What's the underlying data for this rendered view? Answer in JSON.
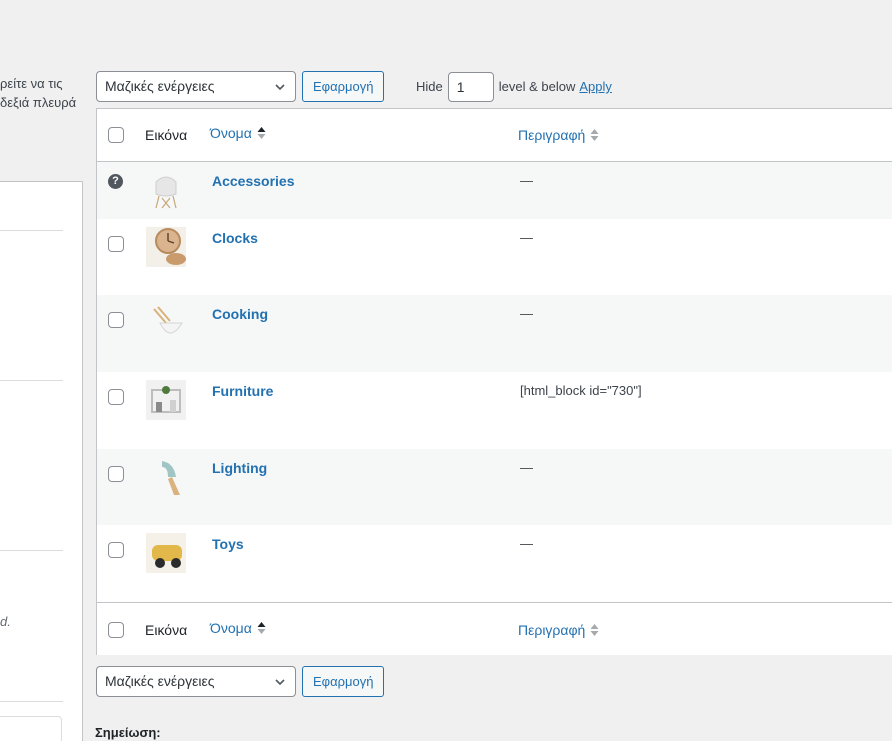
{
  "left": {
    "desc_line1": "ρείτε να τις",
    "desc_line2": "δεξιά πλευρά",
    "italic_text": "d."
  },
  "bulk_top": {
    "selected": "Μαζικές ενέργειες",
    "apply_label": "Εφαρμογή"
  },
  "bulk_bottom": {
    "selected": "Μαζικές ενέργειες",
    "apply_label": "Εφαρμογή"
  },
  "hide_control": {
    "prefix": "Hide",
    "value": "1",
    "suffix": "level & below",
    "apply_link": "Apply"
  },
  "table": {
    "columns": {
      "image": "Εικόνα",
      "name": "Όνομα",
      "description": "Περιγραφή"
    },
    "rows": [
      {
        "name": "Accessories",
        "description": "—",
        "thumb_icon": "chair-thumbnail"
      },
      {
        "name": "Clocks",
        "description": "—",
        "thumb_icon": "clock-thumbnail"
      },
      {
        "name": "Cooking",
        "description": "—",
        "thumb_icon": "bowl-thumbnail"
      },
      {
        "name": "Furniture",
        "description": "[html_block id=\"730\"]",
        "thumb_icon": "shelf-thumbnail"
      },
      {
        "name": "Lighting",
        "description": "—",
        "thumb_icon": "lamp-thumbnail"
      },
      {
        "name": "Toys",
        "description": "—",
        "thumb_icon": "toy-car-thumbnail"
      }
    ]
  },
  "note_label": "Σημείωση:",
  "colors": {
    "link": "#2271b1",
    "background": "#f0f0f1",
    "alt_row": "#f6f7f7",
    "border": "#c3c4c7"
  }
}
